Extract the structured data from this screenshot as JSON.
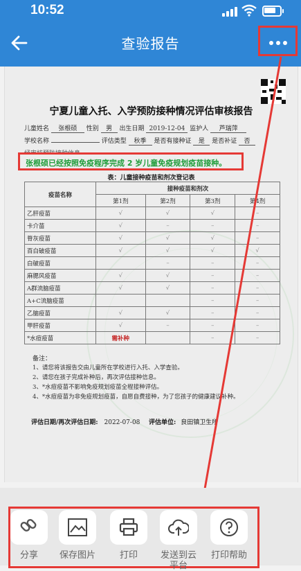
{
  "status_bar": {
    "time": "10:52"
  },
  "nav": {
    "title": "查验报告"
  },
  "document": {
    "title": "宁夏儿童入托、入学预防接种情况评估审核报告",
    "info_row1": {
      "name_label": "儿童姓名",
      "name_value": "张根硕",
      "gender_label": "性别",
      "gender_value": "男",
      "dob_label": "出生日期",
      "dob_value": "2019-12-04",
      "guardian_label": "监护人",
      "guardian_value": "芦瑞萍"
    },
    "info_row2": {
      "school_label": "学校名称",
      "school_value": "",
      "eval_type_label": "评估类型",
      "eval_type_value": "秋季",
      "need_catchup_label": "是否有接种证",
      "need_catchup_value": "是",
      "reissue_label": "是否补证",
      "reissue_value": "否"
    },
    "partial_line": "经审核预防接种信息，",
    "highlight": "张根硕已经按照免疫程序完成 2 岁儿童免疫规划疫苗接种。",
    "table_caption": "表：儿童接种疫苗和剂次登记表",
    "table": {
      "name_header": "疫苗名称",
      "group_header": "接种疫苗和剂次",
      "dose_headers": [
        "第1剂",
        "第2剂",
        "第3剂",
        "第4剂"
      ],
      "rows": [
        {
          "name": "乙肝疫苗",
          "doses": [
            "√",
            "√",
            "√",
            "–"
          ]
        },
        {
          "name": "卡介苗",
          "doses": [
            "√",
            "–",
            "–",
            "–"
          ]
        },
        {
          "name": "脊灰疫苗",
          "doses": [
            "√",
            "√",
            "√",
            "–"
          ]
        },
        {
          "name": "百白破疫苗",
          "doses": [
            "√",
            "√",
            "√",
            "√"
          ]
        },
        {
          "name": "白破疫苗",
          "doses": [
            "",
            "–",
            "–",
            "–"
          ]
        },
        {
          "name": "麻腮风疫苗",
          "doses": [
            "√",
            "√",
            "–",
            "–"
          ]
        },
        {
          "name": "A群流脑疫苗",
          "doses": [
            "√",
            "√",
            "–",
            "–"
          ]
        },
        {
          "name": "A+C流脑疫苗",
          "doses": [
            "",
            "",
            "–",
            "–"
          ]
        },
        {
          "name": "乙脑疫苗",
          "doses": [
            "√",
            "√",
            "–",
            "–"
          ]
        },
        {
          "name": "甲肝疫苗",
          "doses": [
            "√",
            "–",
            "–",
            "–"
          ]
        },
        {
          "name": "*水痘疫苗",
          "doses": [
            "需补种",
            "",
            "–",
            "–"
          ]
        }
      ]
    },
    "notes_title": "备注：",
    "notes": [
      "1、请您将该报告交由儿童所在学校进行入托、入学查验。",
      "2、请您在孩子完成补种后，再次评估接种信息。",
      "3、*水痘疫苗不影响免疫规划疫苗全程接种评估。",
      "4、*水痘疫苗为非免疫规划疫苗，自愿自费接种，为了您孩子的健康建议补种。"
    ],
    "footer": {
      "date_label": "评估日期/再次评估日期:",
      "date_value": "2022-07-08",
      "unit_label": "评估单位:",
      "unit_value": "良田镇卫生所"
    }
  },
  "share_sheet": {
    "actions": [
      {
        "label": "分享",
        "icon": "link-icon"
      },
      {
        "label": "保存图片",
        "icon": "image-icon"
      },
      {
        "label": "打印",
        "icon": "printer-icon"
      },
      {
        "label": "发送到云\n平台",
        "label_line1": "发送到云",
        "label_line2": "平台",
        "icon": "cloud-upload-icon"
      },
      {
        "label": "打印帮助",
        "icon": "help-icon"
      }
    ]
  },
  "colors": {
    "nav_blue": "#2f86d6",
    "annotation_red": "#e53935",
    "highlight_green": "#1f9d3a",
    "catchup_red": "#c62828"
  }
}
